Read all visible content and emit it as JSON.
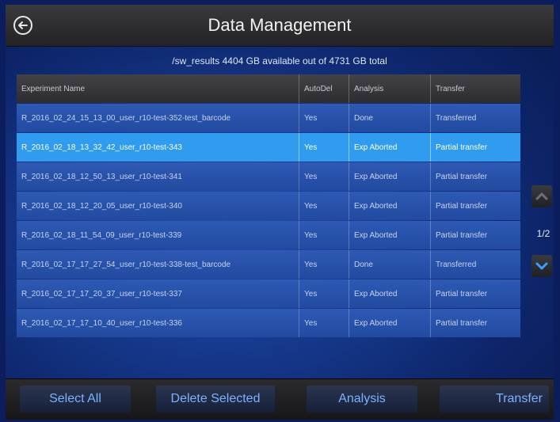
{
  "header": {
    "title": "Data Management",
    "back_icon": "back-arrow-circle-icon"
  },
  "storage_info": "/sw_results  4404 GB available out of 4731 GB total",
  "table": {
    "columns": [
      "Experiment Name",
      "AutoDel",
      "Analysis",
      "Transfer"
    ],
    "rows": [
      {
        "name": "R_2016_02_24_15_13_00_user_r10-test-352-test_barcode",
        "autodel": "Yes",
        "analysis": "Done",
        "transfer": "Transferred"
      },
      {
        "name": "R_2016_02_18_13_32_42_user_r10-test-343",
        "autodel": "Yes",
        "analysis": "Exp Aborted",
        "transfer": "Partial transfer"
      },
      {
        "name": "R_2016_02_18_12_50_13_user_r10-test-341",
        "autodel": "Yes",
        "analysis": "Exp Aborted",
        "transfer": "Partial transfer"
      },
      {
        "name": "R_2016_02_18_12_20_05_user_r10-test-340",
        "autodel": "Yes",
        "analysis": "Exp Aborted",
        "transfer": "Partial transfer"
      },
      {
        "name": "R_2016_02_18_11_54_09_user_r10-test-339",
        "autodel": "Yes",
        "analysis": "Exp Aborted",
        "transfer": "Partial transfer"
      },
      {
        "name": "R_2016_02_17_17_27_54_user_r10-test-338-test_barcode",
        "autodel": "Yes",
        "analysis": "Done",
        "transfer": "Transferred"
      },
      {
        "name": "R_2016_02_17_17_20_37_user_r10-test-337",
        "autodel": "Yes",
        "analysis": "Exp Aborted",
        "transfer": "Partial transfer"
      },
      {
        "name": "R_2016_02_17_17_10_40_user_r10-test-336",
        "autodel": "Yes",
        "analysis": "Exp Aborted",
        "transfer": "Partial transfer"
      }
    ],
    "selected_row": 1
  },
  "pager": {
    "indicator": "1/2",
    "up_icon": "chevron-up-icon",
    "down_icon": "chevron-down-icon"
  },
  "footer": {
    "select_all": "Select All",
    "delete_selected": "Delete Selected",
    "analysis": "Analysis",
    "transfer": "Transfer"
  },
  "colors": {
    "accent": "#2f9cf0",
    "button_text": "#7fb0ff",
    "down_arrow": "#3aa0ff"
  }
}
